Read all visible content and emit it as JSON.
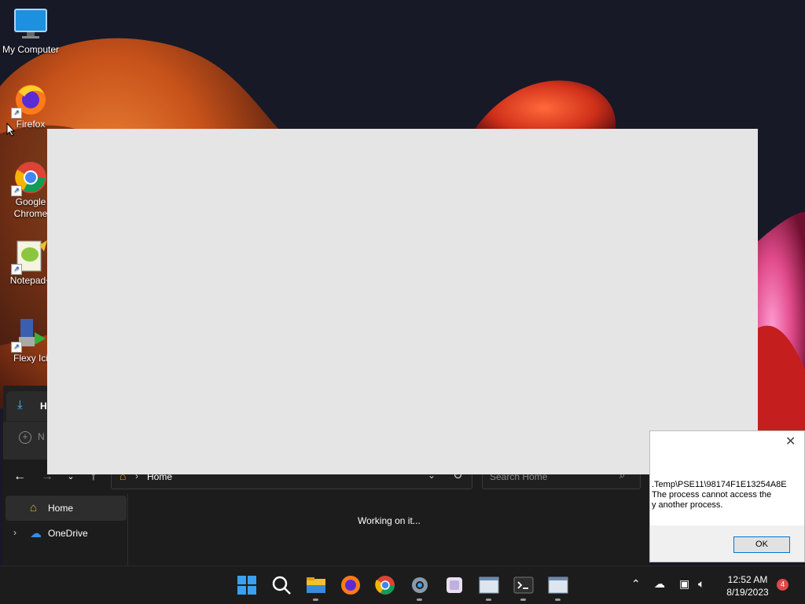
{
  "desktop": {
    "icons": [
      {
        "label": "My Computer",
        "icon": "monitor-icon"
      },
      {
        "label": "Firefox",
        "icon": "firefox-icon"
      },
      {
        "label": "Google Chrome",
        "icon": "chrome-icon"
      },
      {
        "label": "Notepad+",
        "icon": "notepad-plus-icon"
      },
      {
        "label": "Flexy Ici",
        "icon": "flexy-icon"
      }
    ]
  },
  "explorer": {
    "tab_label": "Ho",
    "new_label": "N",
    "address": "Home",
    "search_placeholder": "Search Home",
    "nav_items": [
      {
        "label": "Home",
        "icon": "home-icon",
        "selected": true
      },
      {
        "label": "OneDrive",
        "icon": "onedrive-icon",
        "expandable": true
      }
    ],
    "status": "Working on it..."
  },
  "dialog": {
    "lines": [
      ".Temp\\PSE11\\98174F1E13254A8E",
      " The process cannot access the",
      "y another process."
    ],
    "ok_label": "OK"
  },
  "taskbar": {
    "apps": [
      "start-icon",
      "search-icon",
      "file-explorer-icon",
      "firefox-icon",
      "chrome-icon",
      "settings-icon",
      "app-icon",
      "window-icon",
      "terminal-icon",
      "window-icon"
    ],
    "time": "12:52 AM",
    "date": "8/19/2023",
    "notification_count": "4"
  }
}
